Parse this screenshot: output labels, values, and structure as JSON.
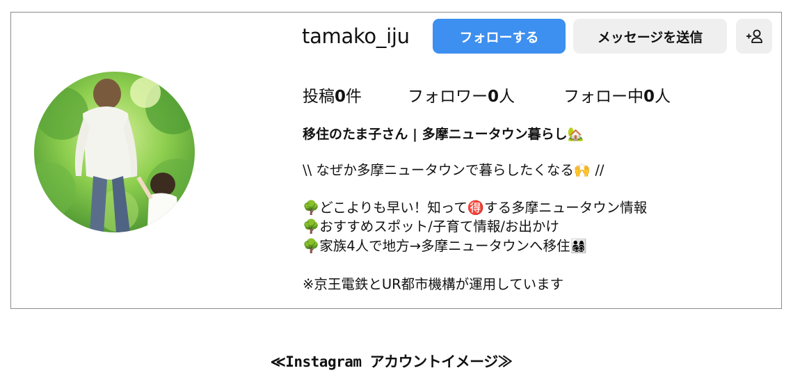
{
  "profile": {
    "username": "tamako_iju",
    "follow_label": "フォローする",
    "message_label": "メッセージを送信",
    "add_user_icon": "add-user-icon"
  },
  "stats": {
    "posts_prefix": "投稿",
    "posts_count": "0",
    "posts_suffix": "件",
    "followers_prefix": "フォロワー",
    "followers_count": "0",
    "followers_suffix": "人",
    "following_prefix": "フォロー中",
    "following_count": "0",
    "following_suffix": "人"
  },
  "bio": {
    "name": "移住のたま子さん | 多摩ニュータウン暮らし🏡",
    "tagline": "\\\\ なぜか多摩ニュータウンで暮らしたくなる🙌 //",
    "line1": "🌳どこよりも早い！知って🉐する多摩ニュータウン情報",
    "line2": "🌳おすすめスポット/子育て情報/お出かけ",
    "line3": "🌳家族4人で地方→多摩ニュータウンへ移住👨‍👩‍👧‍👦",
    "note": "※京王電鉄とUR都市機構が運用しています"
  },
  "caption": "≪Instagram アカウントイメージ≫",
  "colors": {
    "follow_button": "#3d8ff0",
    "secondary_button": "#efefef",
    "card_border": "#8a8a8a"
  }
}
